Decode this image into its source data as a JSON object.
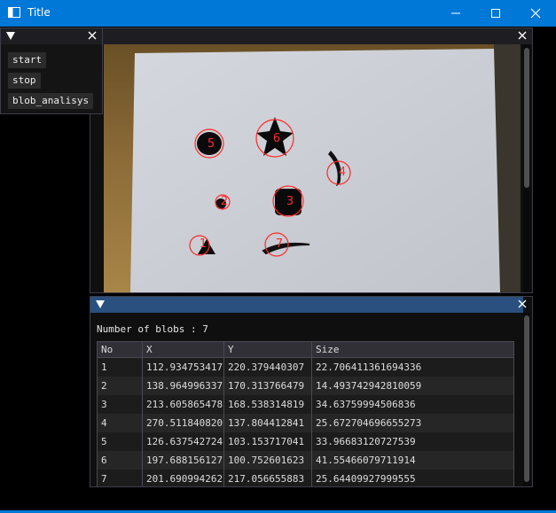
{
  "window": {
    "title": "Title"
  },
  "controls": {
    "buttons": [
      "start",
      "stop",
      "blob_analisys"
    ]
  },
  "image_view": {
    "blob_labels": [
      "5",
      "6",
      "4",
      "2",
      "3",
      "1",
      "7"
    ]
  },
  "results": {
    "count_text": "Number of blobs : 7",
    "columns": [
      "No",
      "X",
      "Y",
      "Size"
    ],
    "rows": [
      [
        "1",
        "112.934753417",
        "220.379440307",
        "22.706411361694336"
      ],
      [
        "2",
        "138.964996337",
        "170.313766479",
        "14.493742942810059"
      ],
      [
        "3",
        "213.605865478",
        "168.538314819",
        "34.63759994506836"
      ],
      [
        "4",
        "270.511840820",
        "137.804412841",
        "25.672704696655273"
      ],
      [
        "5",
        "126.637542724",
        "103.153717041",
        "33.96683120727539"
      ],
      [
        "6",
        "197.688156127",
        "100.752601623",
        "41.55466079711914"
      ],
      [
        "7",
        "201.690994262",
        "217.056655883",
        "25.64409927999555"
      ]
    ]
  },
  "colors": {
    "accent": "#0078d7",
    "active_header": "#29507e",
    "blob_marker": "#ff2a2a"
  }
}
